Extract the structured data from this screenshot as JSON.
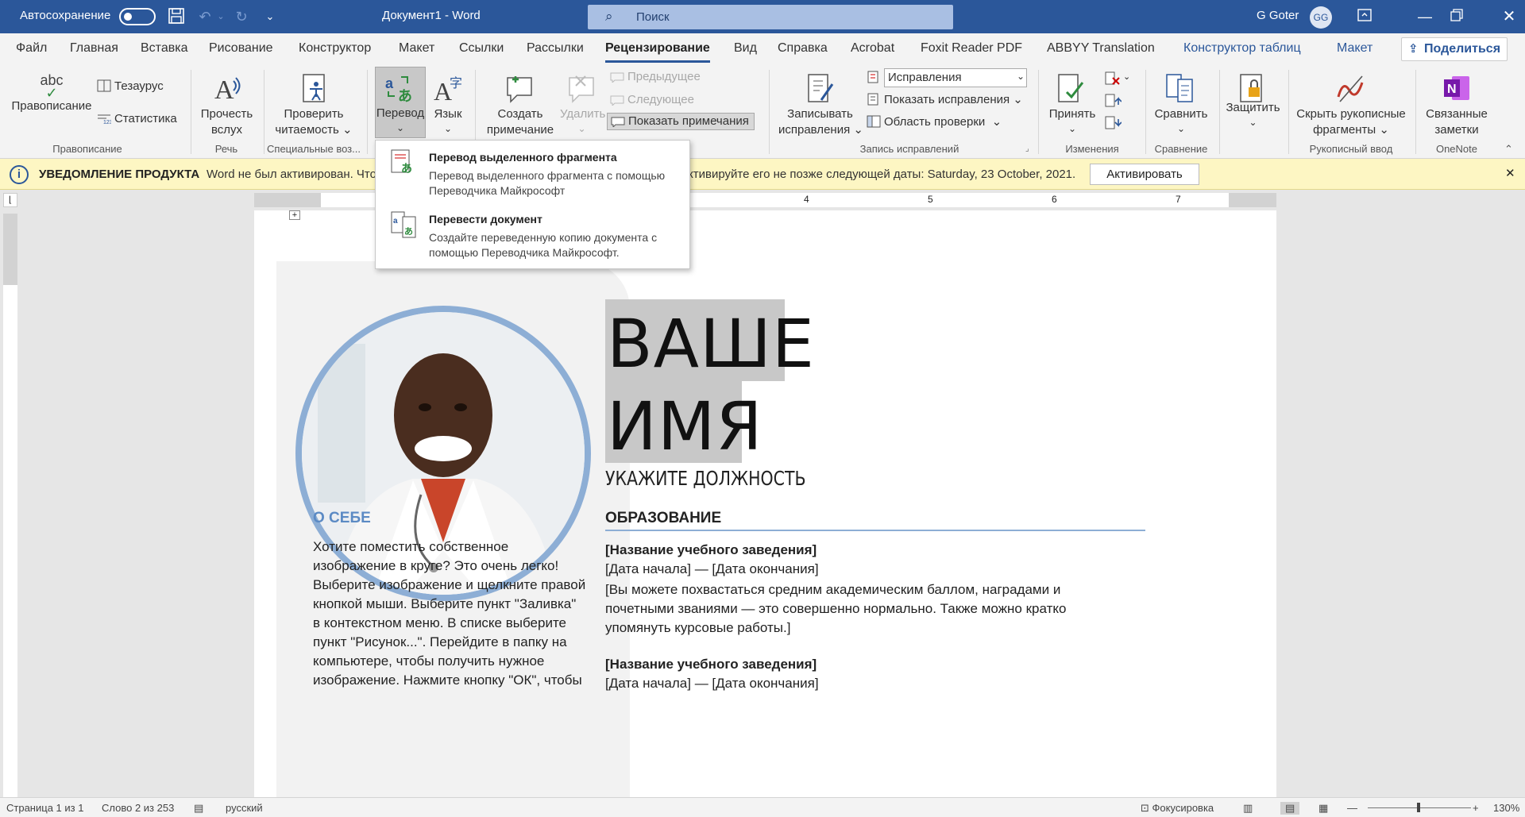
{
  "titlebar": {
    "autosave_label": "Автосохранение",
    "doc_title": "Документ1 - Word",
    "search_placeholder": "Поиск",
    "user_name": "G Goter",
    "user_initials": "GG"
  },
  "tabs": [
    "Файл",
    "Главная",
    "Вставка",
    "Рисование",
    "Конструктор",
    "Макет",
    "Ссылки",
    "Рассылки",
    "Рецензирование",
    "Вид",
    "Справка",
    "Acrobat",
    "Foxit Reader PDF",
    "ABBYY Translation",
    "Конструктор таблиц",
    "Макет"
  ],
  "active_tab": "Рецензирование",
  "share_label": "Поделиться",
  "ribbon": {
    "spelling": "Правописание",
    "thesaurus": "Тезаурус",
    "stats": "Статистика",
    "group_spelling": "Правописание",
    "read_aloud_1": "Прочесть",
    "read_aloud_2": "вслух",
    "group_speech": "Речь",
    "check_1": "Проверить",
    "check_2": "читаемость",
    "group_access": "Специальные воз...",
    "translate": "Перевод",
    "language": "Язык",
    "new_comment_1": "Создать",
    "new_comment_2": "примечание",
    "delete": "Удалить",
    "previous": "Предыдущее",
    "next": "Следующее",
    "show_comments": "Показать примечания",
    "track_1": "Записывать",
    "track_2": "исправления",
    "markup_select": "Исправления",
    "show_markup": "Показать исправления",
    "review_pane": "Область проверки",
    "group_tracking": "Запись исправлений",
    "accept": "Принять",
    "group_changes": "Изменения",
    "compare": "Сравнить",
    "group_compare": "Сравнение",
    "protect": "Защитить",
    "hide_ink_1": "Скрыть рукописные",
    "hide_ink_2": "фрагменты",
    "group_ink": "Рукописный ввод",
    "linked_1": "Связанные",
    "linked_2": "заметки",
    "group_onenote": "OneNote"
  },
  "notification": {
    "title": "УВЕДОМЛЕНИЕ ПРОДУКТА",
    "text_left": "Word не был активирован. Что",
    "text_right": "ктивируйте его не позже следующей даты: Saturday, 23 October, 2021.",
    "button": "Активировать"
  },
  "dropdown": {
    "item1_title": "Перевод выделенного фрагмента",
    "item1_desc": "Перевод выделенного фрагмента с помощью Переводчика Майкрософт",
    "item2_title": "Перевести документ",
    "item2_desc": "Создайте переведенную копию документа с помощью Переводчика Майкрософт."
  },
  "ruler_numbers": [
    "4",
    "5",
    "6",
    "7"
  ],
  "document": {
    "name_line1": "ВАШЕ",
    "name_line2": "ИМЯ",
    "job_title": "УКАЖИТЕ ДОЛЖНОСТЬ",
    "about_heading": "О СЕБЕ",
    "about_text": [
      "Хотите поместить собственное",
      "изображение в круге? Это очень легко!",
      "Выберите изображение и щелкните правой",
      "кнопкой мыши. Выберите пункт \"Заливка\"",
      "в контекстном меню. В списке выберите",
      "пункт \"Рисунок...\". Перейдите в папку на",
      "компьютере, чтобы получить нужное",
      "изображение. Нажмите кнопку \"ОК\", чтобы"
    ],
    "education_heading": "ОБРАЗОВАНИЕ",
    "school1": "[Название учебного заведения]",
    "dates1": "[Дата начала] — [Дата окончания]",
    "desc1": [
      "[Вы можете похвастаться средним академическим баллом, наградами и",
      "почетными званиями — это совершенно нормально. Также можно кратко",
      "упомянуть курсовые работы.]"
    ],
    "school2": "[Название учебного заведения]",
    "dates2": "[Дата начала] — [Дата окончания]"
  },
  "status": {
    "page": "Страница 1 из 1",
    "words": "Слово 2 из 253",
    "language": "русский",
    "focus": "Фокусировка",
    "zoom": "130%"
  }
}
